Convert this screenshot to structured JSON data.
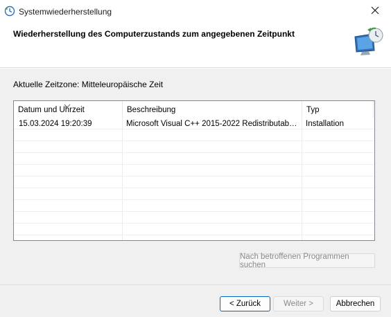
{
  "window": {
    "title": "Systemwiederherstellung",
    "close_icon": "close-icon"
  },
  "header": {
    "title": "Wiederherstellung des Computerzustands zum angegebenen Zeitpunkt",
    "icon": "system-restore-monitor-icon"
  },
  "timezone": {
    "label": "Aktuelle Zeitzone: Mitteleuropäische Zeit"
  },
  "restore_points": {
    "columns": [
      "Datum und Uhrzeit",
      "Beschreibung",
      "Typ"
    ],
    "sorted_column": "Datum und Uhrzeit",
    "rows": [
      {
        "date": "15.03.2024 19:20:39",
        "description": "Microsoft Visual C++ 2015-2022 Redistributable ...",
        "type": "Installation"
      }
    ]
  },
  "actions": {
    "scan_label": "Nach betroffenen Programmen suchen",
    "back_label": "< Zurück",
    "next_label": "Weiter >",
    "cancel_label": "Abbrechen"
  },
  "colors": {
    "accent": "#0067c0",
    "panel_bg": "#f0f0f0",
    "disabled_text": "#8a8a8a"
  }
}
